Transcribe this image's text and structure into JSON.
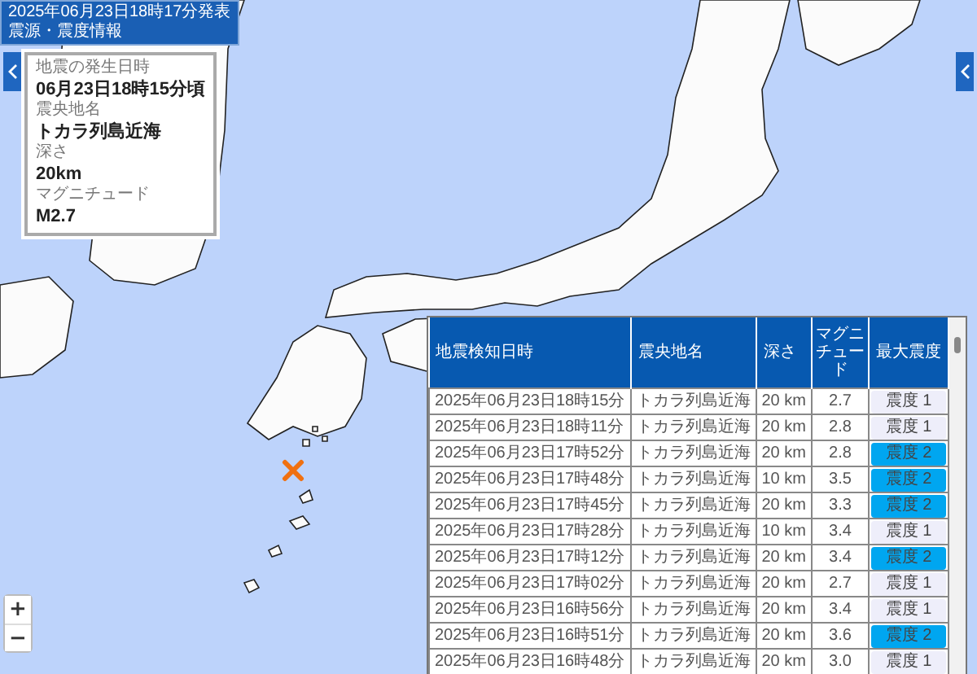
{
  "header": {
    "title": "2025年06月23日18時17分発表",
    "subtitle": "震源・震度情報"
  },
  "info": [
    {
      "label": "地震の発生日時",
      "value": "06月23日18時15分頃"
    },
    {
      "label": "震央地名",
      "value": "トカラ列島近海"
    },
    {
      "label": "深さ",
      "value": "20km"
    },
    {
      "label": "マグニチュード",
      "value": "M2.7"
    }
  ],
  "map_controls": {
    "zoom_in": "+",
    "zoom_out": "−"
  },
  "table": {
    "columns": [
      "地震検知日時",
      "震央地名",
      "深さ",
      "マグニチュード",
      "最大震度"
    ],
    "rows": [
      {
        "time": "2025年06月23日18時15分",
        "place": "トカラ列島近海",
        "depth": "20 km",
        "magnitude": "2.7",
        "intensity": "震度 1",
        "color": "#eeeefa"
      },
      {
        "time": "2025年06月23日18時11分",
        "place": "トカラ列島近海",
        "depth": "20 km",
        "magnitude": "2.8",
        "intensity": "震度 1",
        "color": "#eeeefa"
      },
      {
        "time": "2025年06月23日17時52分",
        "place": "トカラ列島近海",
        "depth": "20 km",
        "magnitude": "2.8",
        "intensity": "震度 2",
        "color": "#00a6f0"
      },
      {
        "time": "2025年06月23日17時48分",
        "place": "トカラ列島近海",
        "depth": "10 km",
        "magnitude": "3.5",
        "intensity": "震度 2",
        "color": "#00a6f0"
      },
      {
        "time": "2025年06月23日17時45分",
        "place": "トカラ列島近海",
        "depth": "20 km",
        "magnitude": "3.3",
        "intensity": "震度 2",
        "color": "#00a6f0"
      },
      {
        "time": "2025年06月23日17時28分",
        "place": "トカラ列島近海",
        "depth": "10 km",
        "magnitude": "3.4",
        "intensity": "震度 1",
        "color": "#eeeefa"
      },
      {
        "time": "2025年06月23日17時12分",
        "place": "トカラ列島近海",
        "depth": "20 km",
        "magnitude": "3.4",
        "intensity": "震度 2",
        "color": "#00a6f0"
      },
      {
        "time": "2025年06月23日17時02分",
        "place": "トカラ列島近海",
        "depth": "20 km",
        "magnitude": "2.7",
        "intensity": "震度 1",
        "color": "#eeeefa"
      },
      {
        "time": "2025年06月23日16時56分",
        "place": "トカラ列島近海",
        "depth": "20 km",
        "magnitude": "3.4",
        "intensity": "震度 1",
        "color": "#eeeefa"
      },
      {
        "time": "2025年06月23日16時51分",
        "place": "トカラ列島近海",
        "depth": "20 km",
        "magnitude": "3.6",
        "intensity": "震度 2",
        "color": "#00a6f0"
      },
      {
        "time": "2025年06月23日16時48分",
        "place": "トカラ列島近海",
        "depth": "20 km",
        "magnitude": "3.0",
        "intensity": "震度 1",
        "color": "#eeeefa"
      }
    ]
  }
}
